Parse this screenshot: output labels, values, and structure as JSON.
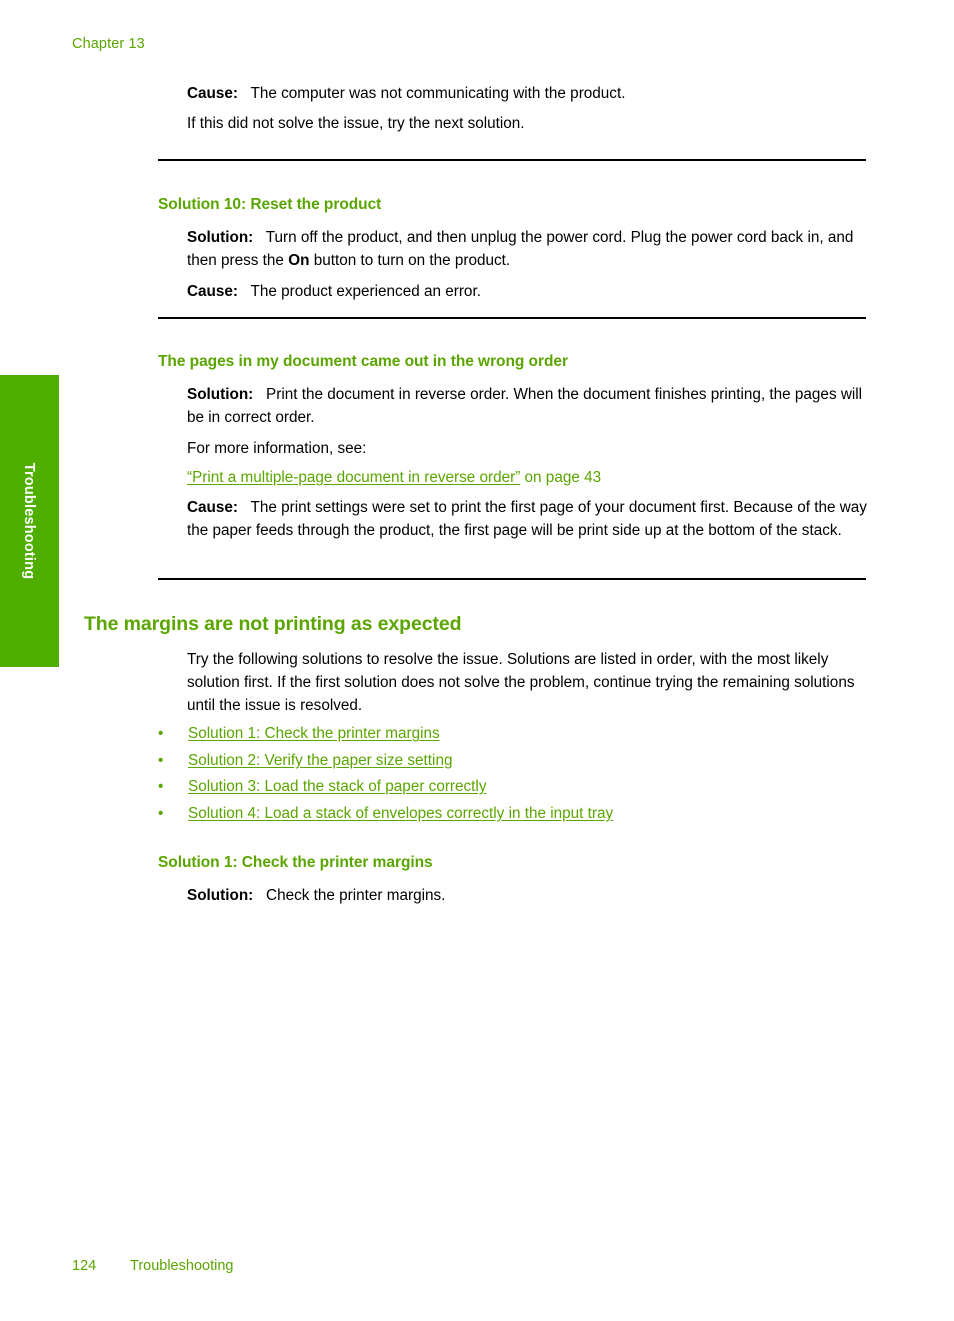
{
  "page": {
    "running_header": "Chapter 13",
    "thumb_tab_label": "Troubleshooting",
    "footer": {
      "page_number": "124",
      "chapter_title": "Troubleshooting"
    },
    "colors": {
      "heading_green": "#5aa500",
      "tab_green": "#4fae00",
      "link_green": "#5aa500",
      "body_black": "#000000",
      "page_background": "#ffffff"
    }
  },
  "blocks": {
    "cause_top": {
      "label": "Cause:",
      "text": "The computer was not communicating with the product."
    },
    "next_solution_note": "If this did not solve the issue, try the next solution.",
    "solution10": {
      "heading": "Solution 10: Reset the product",
      "solution_label": "Solution:",
      "solution_text_a": "Turn off the product, and then unplug the power cord. Plug the power cord back in, and then press the ",
      "solution_bold_on": "On",
      "solution_text_b": " button to turn on the product.",
      "cause_label": "Cause:",
      "cause_text": "The product experienced an error."
    },
    "wrong_order": {
      "heading": "The pages in my document came out in the wrong order",
      "solution_label": "Solution:",
      "solution_text": "Print the document in reverse order. When the document finishes printing, the pages will be in correct order.",
      "more_info": "For more information, see:",
      "xref_link": "“Print a multiple-page document in reverse order”",
      "xref_tail": " on page 43",
      "cause_label": "Cause:",
      "cause_text": "The print settings were set to print the first page of your document first. Because of the way the paper feeds through the product, the first page will be print side up at the bottom of the stack."
    },
    "margins_section": {
      "heading": "The margins are not printing as expected",
      "intro": "Try the following solutions to resolve the issue. Solutions are listed in order, with the most likely solution first. If the first solution does not solve the problem, continue trying the remaining solutions until the issue is resolved.",
      "bullet_marker": "•",
      "links": [
        "Solution 1: Check the printer margins",
        "Solution 2: Verify the paper size setting",
        "Solution 3: Load the stack of paper correctly",
        "Solution 4: Load a stack of envelopes correctly in the input tray"
      ]
    },
    "solution1": {
      "heading": "Solution 1: Check the printer margins",
      "solution_label": "Solution:",
      "solution_text": "Check the printer margins."
    }
  }
}
